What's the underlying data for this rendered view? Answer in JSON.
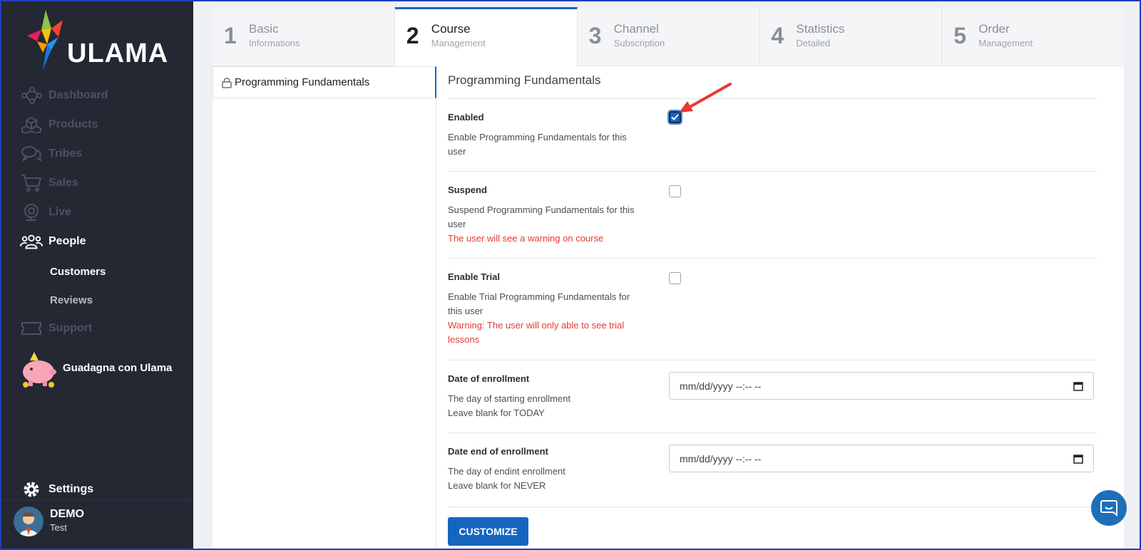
{
  "app": {
    "brand": "ULAMA"
  },
  "sidebar": {
    "items": [
      {
        "label": "Dashboard",
        "icon": "network-icon",
        "state": "muted"
      },
      {
        "label": "Products",
        "icon": "cubes-icon",
        "state": "muted"
      },
      {
        "label": "Tribes",
        "icon": "chat-bubbles-icon",
        "state": "muted"
      },
      {
        "label": "Sales",
        "icon": "cart-icon",
        "state": "muted"
      },
      {
        "label": "Live",
        "icon": "webcam-icon",
        "state": "muted"
      },
      {
        "label": "People",
        "icon": "people-icon",
        "state": "active"
      }
    ],
    "subitems": [
      {
        "label": "Customers",
        "selected": true
      },
      {
        "label": "Reviews",
        "selected": false
      }
    ],
    "support": {
      "label": "Support",
      "icon": "ticket-icon"
    },
    "promo": {
      "label": "Guadagna con Ulama",
      "icon": "piggy-bank-icon"
    },
    "settings": {
      "label": "Settings",
      "icon": "gear-icon"
    },
    "user": {
      "name": "DEMO",
      "role": "Test"
    }
  },
  "steps": [
    {
      "number": "1",
      "title": "Basic",
      "subtitle": "Informations",
      "active": false
    },
    {
      "number": "2",
      "title": "Course",
      "subtitle": "Management",
      "active": true
    },
    {
      "number": "3",
      "title": "Channel",
      "subtitle": "Subscription",
      "active": false
    },
    {
      "number": "4",
      "title": "Statistics",
      "subtitle": "Detailed",
      "active": false
    },
    {
      "number": "5",
      "title": "Order",
      "subtitle": "Management",
      "active": false
    }
  ],
  "course_list": [
    {
      "name": "Programming Fundamentals",
      "icon": "lock-icon"
    }
  ],
  "form": {
    "title": "Programming Fundamentals",
    "enabled": {
      "label": "Enabled",
      "description": "Enable Programming Fundamentals for this user",
      "checked": true
    },
    "suspend": {
      "label": "Suspend",
      "description": "Suspend Programming Fundamentals for this user",
      "warning": "The user will see a warning on course",
      "checked": false
    },
    "trial": {
      "label": "Enable Trial",
      "description": "Enable Trial Programming Fundamentals for this user",
      "warning": "Warning: The user will only able to see trial lessons",
      "checked": false
    },
    "enroll_start": {
      "label": "Date of enrollment",
      "description1": "The day of starting enrollment",
      "description2": "Leave blank for TODAY",
      "placeholder": "mm/dd/yyyy --:-- --"
    },
    "enroll_end": {
      "label": "Date end of enrollment",
      "description1": "The day of endint enrollment",
      "description2": "Leave blank for NEVER",
      "placeholder": "mm/dd/yyyy --:-- --"
    },
    "customize_label": "CUSTOMIZE"
  },
  "colors": {
    "accent": "#1565c0",
    "sidebar_bg": "#232833",
    "warning": "#e53935",
    "annotation_arrow": "#e53935"
  }
}
